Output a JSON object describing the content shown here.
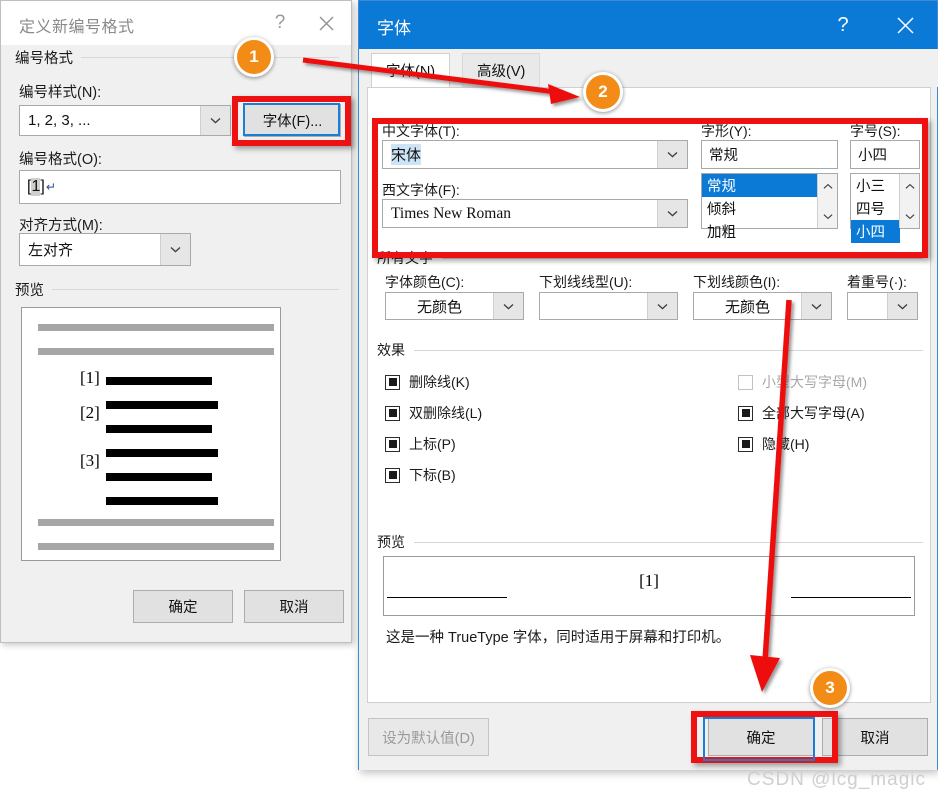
{
  "numbering_dialog": {
    "title": "定义新编号格式",
    "help_icon": "?",
    "close_icon": "close-icon",
    "section_number_format": "编号格式",
    "number_style_label": "编号样式(N):",
    "number_style_value": "1, 2, 3, ...",
    "font_button": "字体(F)...",
    "number_format_label": "编号格式(O):",
    "number_format_value_prefix": "[",
    "number_format_value_selected": "1",
    "number_format_value_suffix": "]",
    "number_format_pilcrow": "↵",
    "alignment_label": "对齐方式(M):",
    "alignment_value": "左对齐",
    "preview_label": "预览",
    "preview_items": [
      "[1]",
      "[2]",
      "[3]"
    ],
    "ok_button": "确定",
    "cancel_button": "取消"
  },
  "font_dialog": {
    "title": "字体",
    "help_icon": "?",
    "close_icon": "close-icon",
    "tabs": [
      {
        "label": "字体(N)",
        "active": true
      },
      {
        "label": "高级(V)",
        "active": false
      }
    ],
    "chinese_font_label": "中文字体(T):",
    "chinese_font_value": "宋体",
    "western_font_label": "西文字体(F):",
    "western_font_value": "Times New Roman",
    "style_label": "字形(Y):",
    "style_value": "常规",
    "style_options": [
      "常规",
      "倾斜",
      "加粗"
    ],
    "style_selected": "常规",
    "size_label": "字号(S):",
    "size_value": "小四",
    "size_options": [
      "小三",
      "四号",
      "小四"
    ],
    "size_selected": "小四",
    "all_text_section": "所有文字",
    "font_color_label": "字体颜色(C):",
    "font_color_value": "无颜色",
    "underline_style_label": "下划线线型(U):",
    "underline_style_value": "",
    "underline_color_label": "下划线颜色(I):",
    "underline_color_value": "无颜色",
    "emphasis_label": "着重号(·):",
    "emphasis_value": "",
    "effects_section": "效果",
    "effects_left": [
      {
        "label": "删除线(K)",
        "state": "indeterminate",
        "disabled": false
      },
      {
        "label": "双删除线(L)",
        "state": "indeterminate",
        "disabled": false
      },
      {
        "label": "上标(P)",
        "state": "indeterminate",
        "disabled": false
      },
      {
        "label": "下标(B)",
        "state": "indeterminate",
        "disabled": false
      }
    ],
    "effects_right": [
      {
        "label": "小型大写字母(M)",
        "state": "unchecked",
        "disabled": true
      },
      {
        "label": "全部大写字母(A)",
        "state": "indeterminate",
        "disabled": false
      },
      {
        "label": "隐藏(H)",
        "state": "indeterminate",
        "disabled": false
      }
    ],
    "preview_label": "预览",
    "preview_text": "[1]",
    "preview_note": "这是一种 TrueType 字体，同时适用于屏幕和打印机。",
    "set_default_button": "设为默认值(D)",
    "ok_button": "确定",
    "cancel_button": "取消"
  },
  "annotations": {
    "badges": [
      "1",
      "2",
      "3"
    ],
    "highlight_color": "#ee1111",
    "badge_color": "#f28c17",
    "focus_color": "#1a7fd4",
    "arrow_color": "#ee1111"
  },
  "watermark": "CSDN @lcg_magic"
}
